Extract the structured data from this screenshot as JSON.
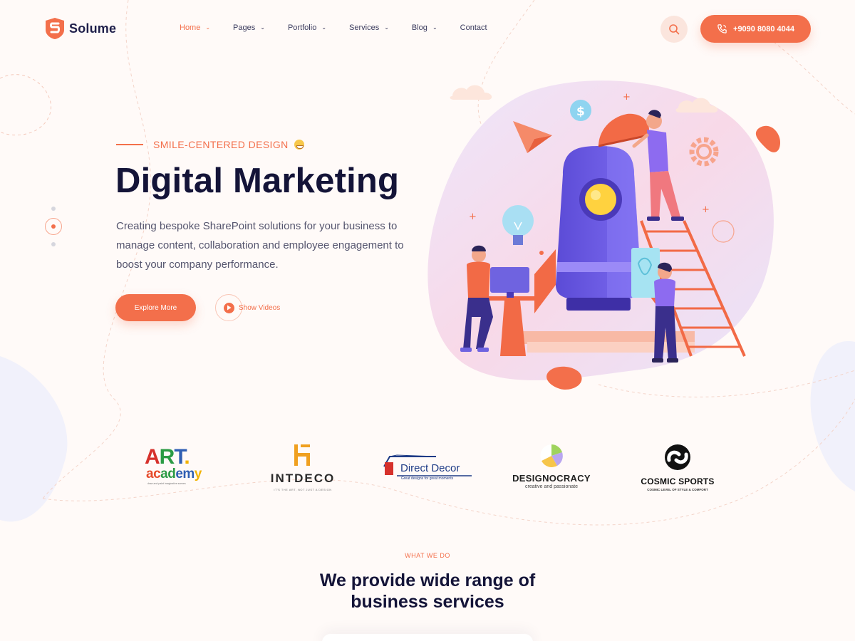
{
  "brand": {
    "name": "Solume",
    "accent": "#f36f4b",
    "dark": "#141438"
  },
  "nav": {
    "items": [
      {
        "label": "Home",
        "dropdown": true,
        "active": true
      },
      {
        "label": "Pages",
        "dropdown": true
      },
      {
        "label": "Portfolio",
        "dropdown": true
      },
      {
        "label": "Services",
        "dropdown": true
      },
      {
        "label": "Blog",
        "dropdown": true
      },
      {
        "label": "Contact",
        "dropdown": false
      }
    ],
    "search_icon": "search-icon",
    "phone": {
      "icon": "phone-icon",
      "label": "+9090 8080 4044"
    }
  },
  "hero": {
    "eyebrow": "SMILE-CENTERED DESIGN",
    "title": "Digital Marketing",
    "description": "Creating bespoke SharePoint solutions for your business to manage content, collaboration and employee engagement to boost your company performance.",
    "primary_button": "Explore More",
    "video_button": "Show Videos"
  },
  "slider": {
    "total": 3,
    "active_index": 1
  },
  "partners": {
    "art_academy": {
      "art": "ART",
      "academy": "academy",
      "tagline": "draw and paint imaginative scenes"
    },
    "intdeco": {
      "name": "INTDECO",
      "tagline": "IT'S THE ART, NOT JUST A DESIGN"
    },
    "direct_decor": {
      "name": "Direct Decor",
      "tagline": "Great designs for great moments"
    },
    "designocracy": {
      "name": "DESIGNOCRACY",
      "tagline": "creative and passionate"
    },
    "cosmic_sports": {
      "name": "COSMIC SPORTS",
      "tagline": "COSMIC LEVEL OF STYLE & COMFORT"
    }
  },
  "what_we_do": {
    "eyebrow": "WHAT WE DO",
    "title_line1": "We provide wide range of",
    "title_line2": "business services"
  }
}
